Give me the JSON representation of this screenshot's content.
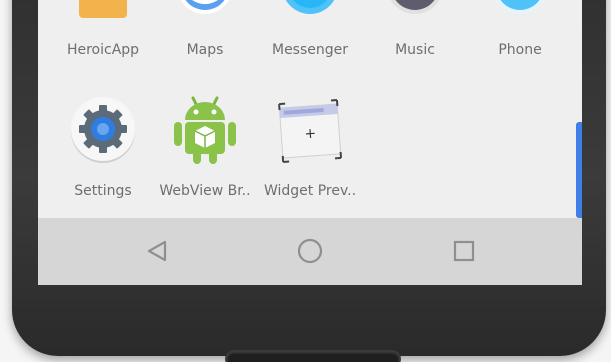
{
  "apps_top_row": [
    {
      "label": "HeroicApp",
      "icon": "heroicapp-icon"
    },
    {
      "label": "Maps",
      "icon": "maps-icon"
    },
    {
      "label": "Messenger",
      "icon": "messenger-icon"
    },
    {
      "label": "Music",
      "icon": "music-icon"
    },
    {
      "label": "Phone",
      "icon": "phone-icon"
    }
  ],
  "apps_bottom_row": [
    {
      "label": "Settings",
      "icon": "gear-icon"
    },
    {
      "label": "WebView Br..",
      "icon": "android-icon"
    },
    {
      "label": "Widget Prev..",
      "icon": "widget-preview-icon"
    }
  ],
  "navigation": {
    "back": "back-triangle-icon",
    "home": "home-circle-icon",
    "recents": "recents-square-icon"
  },
  "colors": {
    "accent": "#3f7fe6",
    "drawer_bg": "#efefef",
    "navbar_bg": "#d6d6d6",
    "android_green": "#8bc34a"
  }
}
